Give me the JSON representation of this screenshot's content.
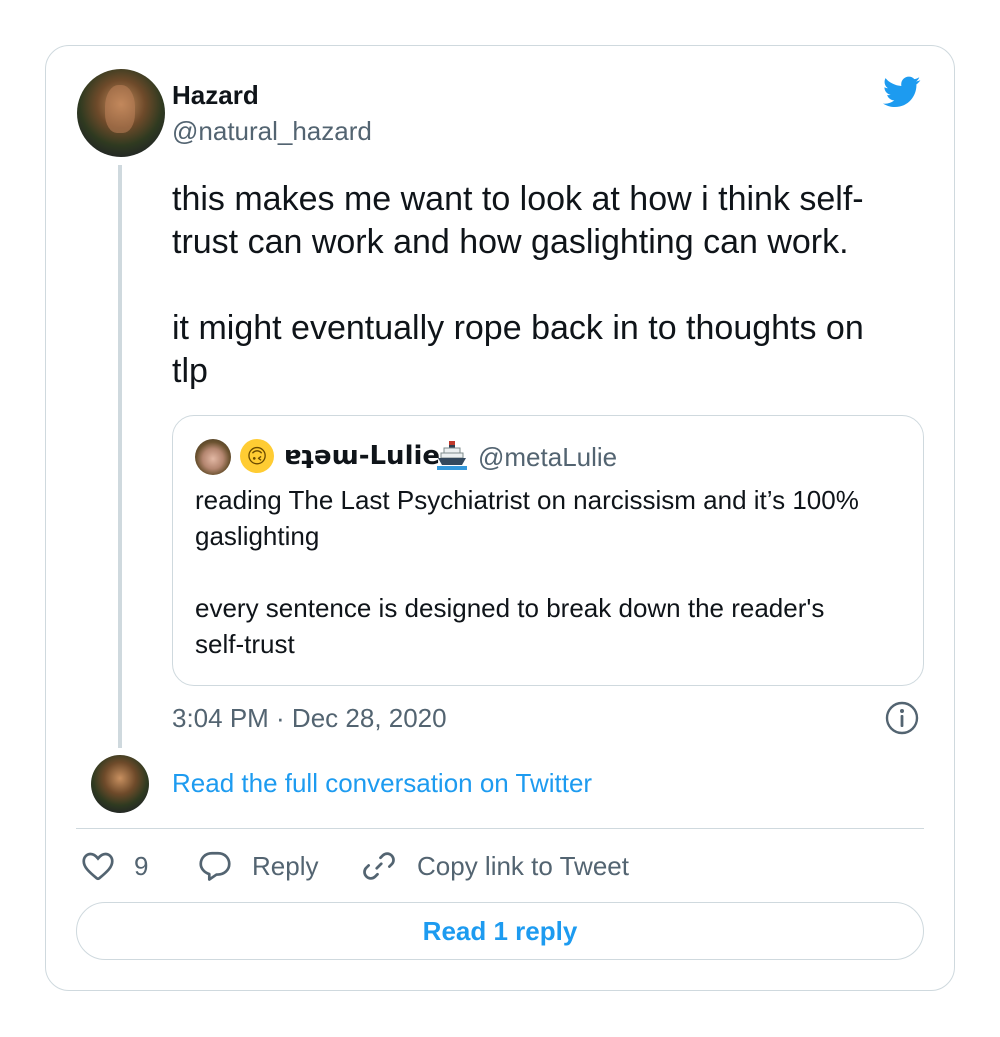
{
  "author": {
    "name": "Hazard",
    "handle": "@natural_hazard"
  },
  "tweet": {
    "text": "this makes me want to look at how i think self-\ntrust can work and how gaslighting can work.\n\nit might eventually rope back in to thoughts on\ntlp",
    "timestamp": "3:04 PM · Dec 28, 2020"
  },
  "quote": {
    "name_emoji": "🙃",
    "name": "ɐʇǝɯ-Lulie",
    "name_suffix_icon": "ship-icon",
    "handle": "@metaLulie",
    "text": "reading The Last Psychiatrist on narcissism and it’s 100%\ngaslighting\n\nevery sentence is designed to break down the reader's\nself-trust"
  },
  "conversation_link": "Read the full conversation on Twitter",
  "actions": {
    "like_count": "9",
    "reply_label": "Reply",
    "copy_label": "Copy link to Tweet"
  },
  "read_replies_label": "Read 1 reply",
  "colors": {
    "accent": "#1d9bf0",
    "text": "#0f1419",
    "secondary": "#536471",
    "border": "#cfd9de"
  }
}
